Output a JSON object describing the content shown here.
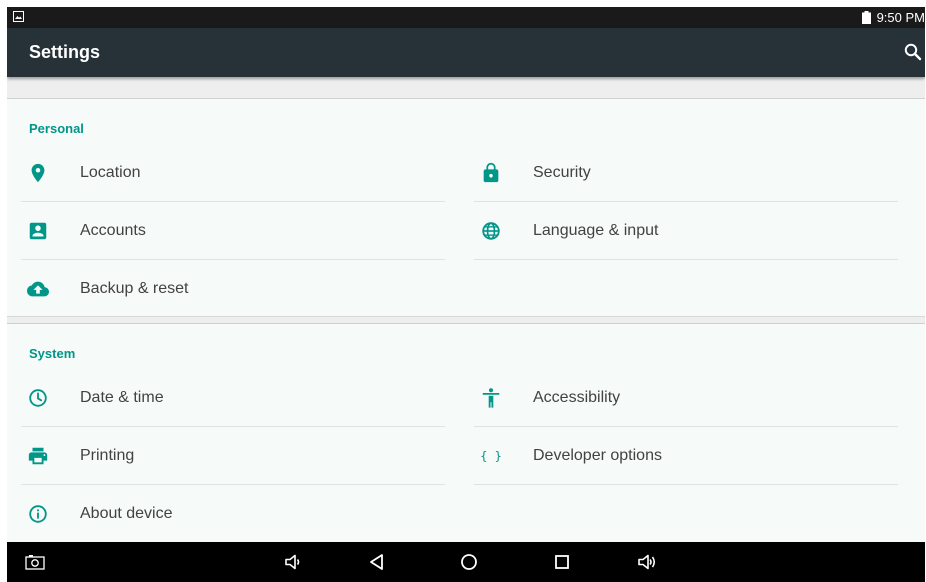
{
  "status_bar": {
    "time": "9:50 PM",
    "left_icon": "image-notification-icon",
    "battery_icon": "battery-icon"
  },
  "action_bar": {
    "title": "Settings",
    "search_icon": "search-icon"
  },
  "sections": [
    {
      "title": "Personal",
      "items": [
        {
          "label": "Location",
          "icon": "location-pin-icon"
        },
        {
          "label": "Security",
          "icon": "lock-icon"
        },
        {
          "label": "Accounts",
          "icon": "account-box-icon"
        },
        {
          "label": "Language & input",
          "icon": "globe-icon"
        },
        {
          "label": "Backup & reset",
          "icon": "cloud-upload-icon"
        }
      ]
    },
    {
      "title": "System",
      "items": [
        {
          "label": "Date & time",
          "icon": "clock-icon"
        },
        {
          "label": "Accessibility",
          "icon": "accessibility-icon"
        },
        {
          "label": "Printing",
          "icon": "printer-icon"
        },
        {
          "label": "Developer options",
          "icon": "braces-icon"
        },
        {
          "label": "About device",
          "icon": "info-icon"
        }
      ]
    }
  ],
  "nav_bar": {
    "buttons": [
      "screenshot-icon",
      "volume-down-icon",
      "back-icon",
      "home-icon",
      "recents-icon",
      "volume-up-icon"
    ]
  },
  "colors": {
    "accent": "#009688",
    "action_bar": "#263238",
    "status_bar": "#1a1a1a",
    "background": "#eeeeee",
    "card": "#f6faf8",
    "text": "#424242"
  }
}
